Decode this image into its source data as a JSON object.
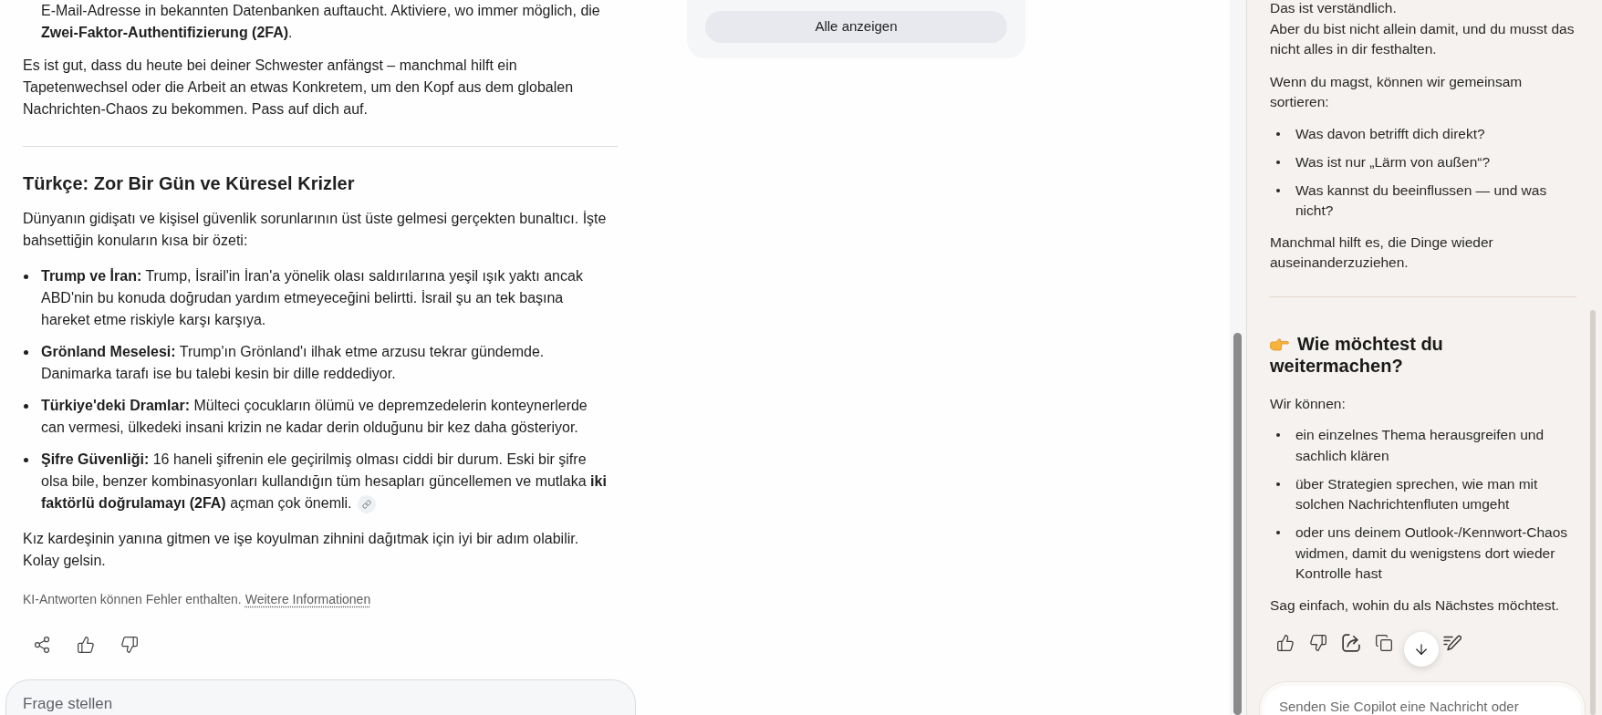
{
  "answer": {
    "blocks": [
      {
        "kind": "continuation",
        "text": "E-Mail-Adresse in bekannten Datenbanken auftaucht. Aktiviere, wo immer möglich, die **Zwei-Faktor-Authentifizierung (2FA)**."
      },
      {
        "kind": "paragraph",
        "text": "Es ist gut, dass du heute bei deiner Schwester anfängst – manchmal hilft ein Tapetenwechsel oder die Arbeit an etwas Konkretem, um den Kopf aus dem globalen Nachrichten-Chaos zu bekommen. Pass auf dich auf."
      },
      {
        "kind": "divider"
      },
      {
        "kind": "heading",
        "text": "Türkçe: Zor Bir Gün ve Küresel Krizler"
      },
      {
        "kind": "paragraph",
        "text": "Dünyanın gidişatı ve kişisel güvenlik sorunlarının üst üste gelmesi gerçekten bunaltıcı. İşte bahsettiğin konuların kısa bir özeti:"
      },
      {
        "kind": "bullet",
        "text": "**Trump ve İran:** Trump, İsrail'in İran'a yönelik olası saldırılarına yeşil ışık yaktı ancak ABD'nin bu konuda doğrudan yardım etmeyeceğini belirtti. İsrail şu an tek başına hareket etme riskiyle karşı karşıya.",
        "source_link": false
      },
      {
        "kind": "bullet",
        "text": "**Grönland Meselesi:** Trump'ın Grönland'ı ilhak etme arzusu tekrar gündemde. Danimarka tarafı ise bu talebi kesin bir dille reddediyor.",
        "source_link": false
      },
      {
        "kind": "bullet",
        "text": "**Türkiye'deki Dramlar:** Mülteci çocukların ölümü ve depremzedelerin konteynerlerde can vermesi, ülkedeki insani krizin ne kadar derin olduğunu bir kez daha gösteriyor.",
        "source_link": false
      },
      {
        "kind": "bullet",
        "text": "**Şifre Güvenliği:** 16 haneli şifrenin ele geçirilmiş olması ciddi bir durum. Eski bir şifre olsa bile, benzer kombinasyonları kullandığın tüm hesapları güncellemen ve mutlaka **iki faktörlü doğrulamayı (2FA)** açman çok önemli.",
        "source_link": true
      },
      {
        "kind": "paragraph",
        "text": "Kız kardeşinin yanına gitmen ve işe koyulman zihnini dağıtmak için iyi bir adım olabilir. Kolay gelsin."
      }
    ],
    "disclaimer": {
      "text": "KI-Antworten können Fehler enthalten.",
      "link": "Weitere Informationen"
    },
    "actions": [
      {
        "kind": "share"
      },
      {
        "kind": "like"
      },
      {
        "kind": "dislike"
      }
    ],
    "ask_field": {
      "placeholder": "Frage stellen"
    }
  },
  "sources_card": {
    "button": "Alle anzeigen"
  },
  "copilot": {
    "blocks": [
      {
        "kind": "lines",
        "lines": [
          "Das ist verständlich.",
          "Aber du bist nicht allein damit, und du musst das nicht alles in dir festhalten."
        ]
      },
      {
        "kind": "paragraph",
        "text": "Wenn du magst, können wir gemeinsam sortieren:"
      },
      {
        "kind": "bullets",
        "items": [
          "Was davon betrifft dich direkt?",
          "Was ist nur „Lärm von außen“?",
          "Was kannst du beeinflussen — und was nicht?"
        ]
      },
      {
        "kind": "paragraph",
        "text": "Manchmal hilft es, die Dinge wieder auseinanderzuziehen."
      },
      {
        "kind": "divider"
      },
      {
        "kind": "heading",
        "icon": true,
        "text": "Wie möchtest du weitermachen?"
      },
      {
        "kind": "paragraph",
        "text": "Wir können:"
      },
      {
        "kind": "bullets",
        "items": [
          "ein einzelnes Thema herausgreifen und sachlich klären",
          "über Strategien sprechen, wie man mit solchen Nachrichtenfluten umgeht",
          "oder uns deinem Outlook-/Kennwort-Chaos widmen, damit du wenigstens dort wieder Kontrolle hast"
        ]
      },
      {
        "kind": "paragraph",
        "text": "Sag einfach, wohin du als Nächstes möchtest."
      }
    ],
    "actions": [
      {
        "kind": "like"
      },
      {
        "kind": "dislike"
      },
      {
        "kind": "share"
      },
      {
        "kind": "copy"
      },
      {
        "kind": "edit"
      }
    ],
    "scroll_down_button": true,
    "composer": {
      "placeholder": "Senden Sie Copilot eine Nachricht oder"
    }
  }
}
